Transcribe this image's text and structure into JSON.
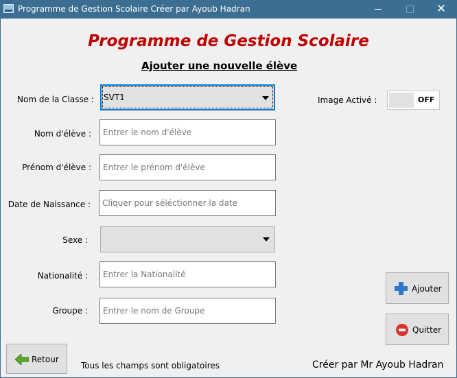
{
  "window": {
    "title": "Programme de Gestion Scolaire Créer par Ayoub Hadran",
    "minimize": "—",
    "maximize": "☐",
    "close": "✕"
  },
  "header": {
    "title": "Programme de Gestion Scolaire",
    "subtitle": "Ajouter une nouvelle élève"
  },
  "form": {
    "classe_label": "Nom de la Classe :",
    "classe_value": "SVT1",
    "nom_label": "Nom d'élève :",
    "nom_placeholder": "Entrer le nom d'élève",
    "prenom_label": "Prénom d'élève :",
    "prenom_placeholder": "Entrer le prénom d'élève",
    "date_label": "Date de Naissance :",
    "date_placeholder": "Cliquer pour séléctionner la date",
    "sexe_label": "Sexe :",
    "sexe_value": "",
    "nationalite_label": "Nationalité :",
    "nationalite_placeholder": "Entrer la Nationalité",
    "groupe_label": "Groupe :",
    "groupe_placeholder": "Entrer le nom de Groupe"
  },
  "image_toggle": {
    "label": "Image Activé :",
    "state": "OFF"
  },
  "buttons": {
    "ajouter": "Ajouter",
    "quitter": "Quitter",
    "retour": "Retour"
  },
  "footer": {
    "note": "Tous les champs sont obligatoires",
    "credit": "Créer par Mr Ayoub Hadran"
  },
  "colors": {
    "titlebar": "#3c6e91",
    "heading": "#c00000",
    "focus": "#0078d7",
    "add_icon": "#2f77c8",
    "quit_icon": "#d9352b",
    "back_icon": "#5aa82a"
  },
  "icons": [
    "app-icon",
    "plus-icon",
    "minus-circle-icon",
    "arrow-left-icon",
    "chevron-down-icon"
  ]
}
